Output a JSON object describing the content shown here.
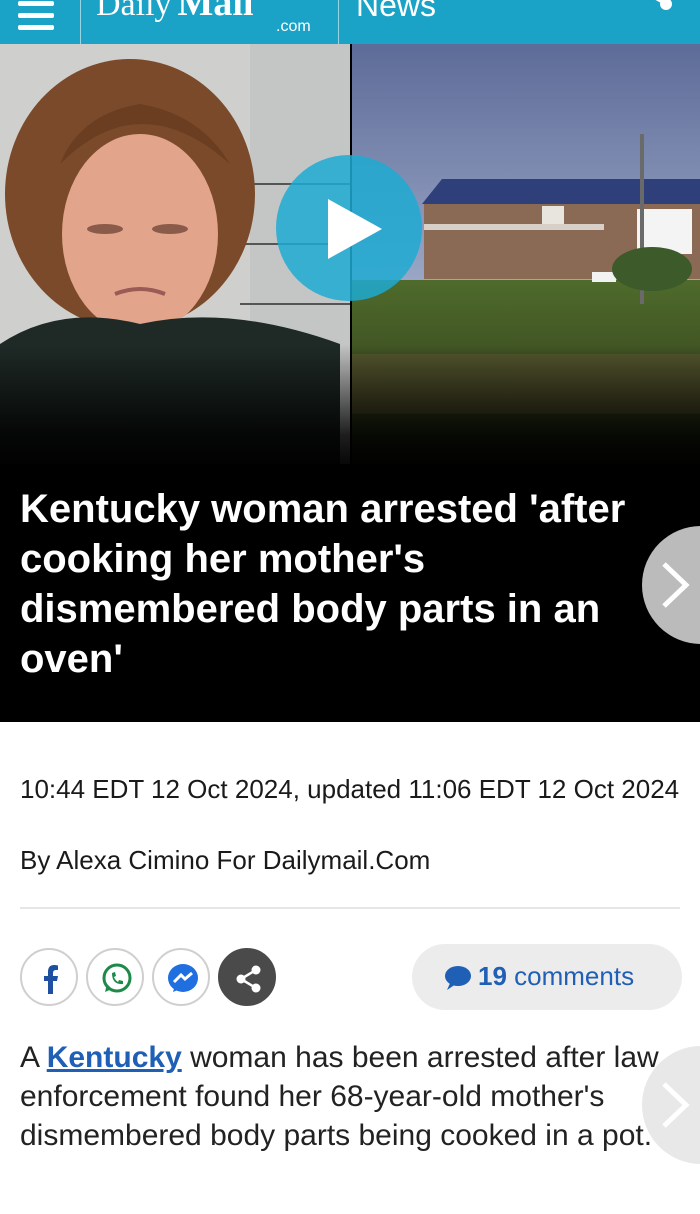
{
  "header": {
    "logo_daily": "Daily",
    "logo_mail": "Mail",
    "logo_com": ".com",
    "section": "News"
  },
  "colors": {
    "header_bg": "#1aa3c6",
    "link": "#1f5fb5",
    "headline_bg": "#000000"
  },
  "article": {
    "headline": "Kentucky woman arrested 'after cooking her mother's dismembered body parts in an oven'",
    "timestamp": "10:44 EDT 12 Oct 2024, updated 11:06 EDT 12 Oct 2024",
    "byline": "By Alexa Cimino For Dailymail.Com",
    "comments_count": "19",
    "comments_label": "comments",
    "body_prefix": "A ",
    "body_link": "Kentucky",
    "body_rest": " woman has been arrested after law enforcement found her 68-year-old mother's dismembered body parts being cooked in a pot."
  },
  "icons": {
    "menu": "hamburger-icon",
    "share_top": "share-icon",
    "play": "play-icon",
    "next": "chevron-right-icon",
    "facebook": "facebook-icon",
    "whatsapp": "whatsapp-icon",
    "messenger": "messenger-icon",
    "share": "share-icon",
    "comment": "comment-bubble-icon"
  }
}
